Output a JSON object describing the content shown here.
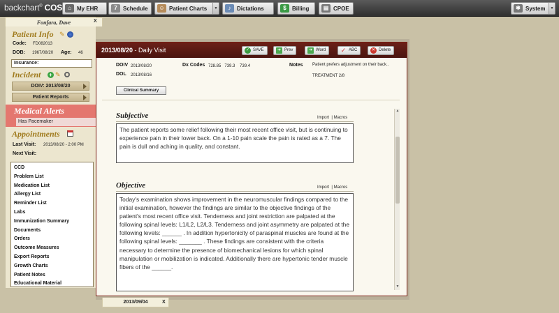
{
  "app": {
    "logo_main": "backchart",
    "logo_suffix": "COS",
    "logo_reg": "®"
  },
  "nav": {
    "my_ehr": "My EHR",
    "schedule": "Schedule",
    "patient_charts": "Patient Charts",
    "dictations": "Dictations",
    "billing": "Billing",
    "cpoe": "CPOE",
    "system": "System"
  },
  "patient": {
    "tab_name": "Fonfara, Dave",
    "tab_close": "X",
    "info_title": "Patient Info",
    "code_label": "Code:",
    "code": "FD082013",
    "dob_label": "DOB:",
    "dob": "1967/08/20",
    "age_label": "Age:",
    "age": "46",
    "insurance_label": "Insurance:"
  },
  "incident": {
    "title": "Incident",
    "doiv_button": "DOIV: 2013/08/20",
    "reports_button": "Patient Reports"
  },
  "alerts": {
    "title": "Medical Alerts",
    "item": "Has Pacemaker"
  },
  "appointments": {
    "title": "Appointments",
    "last_label": "Last Visit:",
    "last_value": "2013/08/20 - 2:00 PM",
    "next_label": "Next Visit:"
  },
  "sidebar": {
    "items": [
      "CCD",
      "Problem List",
      "Medication List",
      "Allergy List",
      "Reminder List",
      "Labs",
      "Immunization Summary",
      "Documents",
      "Orders",
      "Outcome Measures",
      "Export Reports",
      "Growth Charts",
      "Patient Notes",
      "Educational Material"
    ]
  },
  "visit": {
    "date": "2013/08/20",
    "type": " - Daily Visit",
    "toolbar": {
      "save": "SAVE",
      "prev": "Prev",
      "word": "Word",
      "abc": "ABC",
      "delete": "Delete"
    },
    "doiv_label": "DOIV",
    "doiv": "2013/08/20",
    "dol_label": "DOL",
    "dol": "2013/08/16",
    "dx_label": "Dx Codes",
    "dx_codes": "728.85   739.3    739.4",
    "notes_label": "Notes",
    "notes_text": "Patient prefers adjustment on their back..",
    "notes_treatment": "TREATMENT 2/8",
    "clinical_summary": "Clinical Summary"
  },
  "sections": {
    "import": "Import",
    "sep": "|",
    "macros": "Macros",
    "subjective_title": "Subjective",
    "subjective_text": "The patient reports some relief following their most recent office visit, but is continuing to experience pain in their lower back.  On a 1-10 pain scale the pain is rated as a 7.  The pain is dull and aching in quality, and constant.",
    "objective_title": "Objective",
    "objective_text": "Today's examination shows improvement in the neuromuscular findings compared to the initial examination, however the findings are similar to the objective findings of the patient's most recent office visit.  Tenderness and joint restriction are palpated at the following spinal levels:  L1/L2, L2/L3.  Tenderness and joint asymmetry are palpated at the following levels:  ______ .  In addition hypertonicity of paraspinal muscles are found at the following spinal levels: _______ .  These findings are consistent with the criteria necessary to determine the presence of biomechanical lesions for which spinal manipulation or mobilization is indicated.  Additionally there are hypertonic tender muscle fibers of the ______."
  },
  "bottom_tab": {
    "label": "2013/09/04",
    "close": "X"
  }
}
